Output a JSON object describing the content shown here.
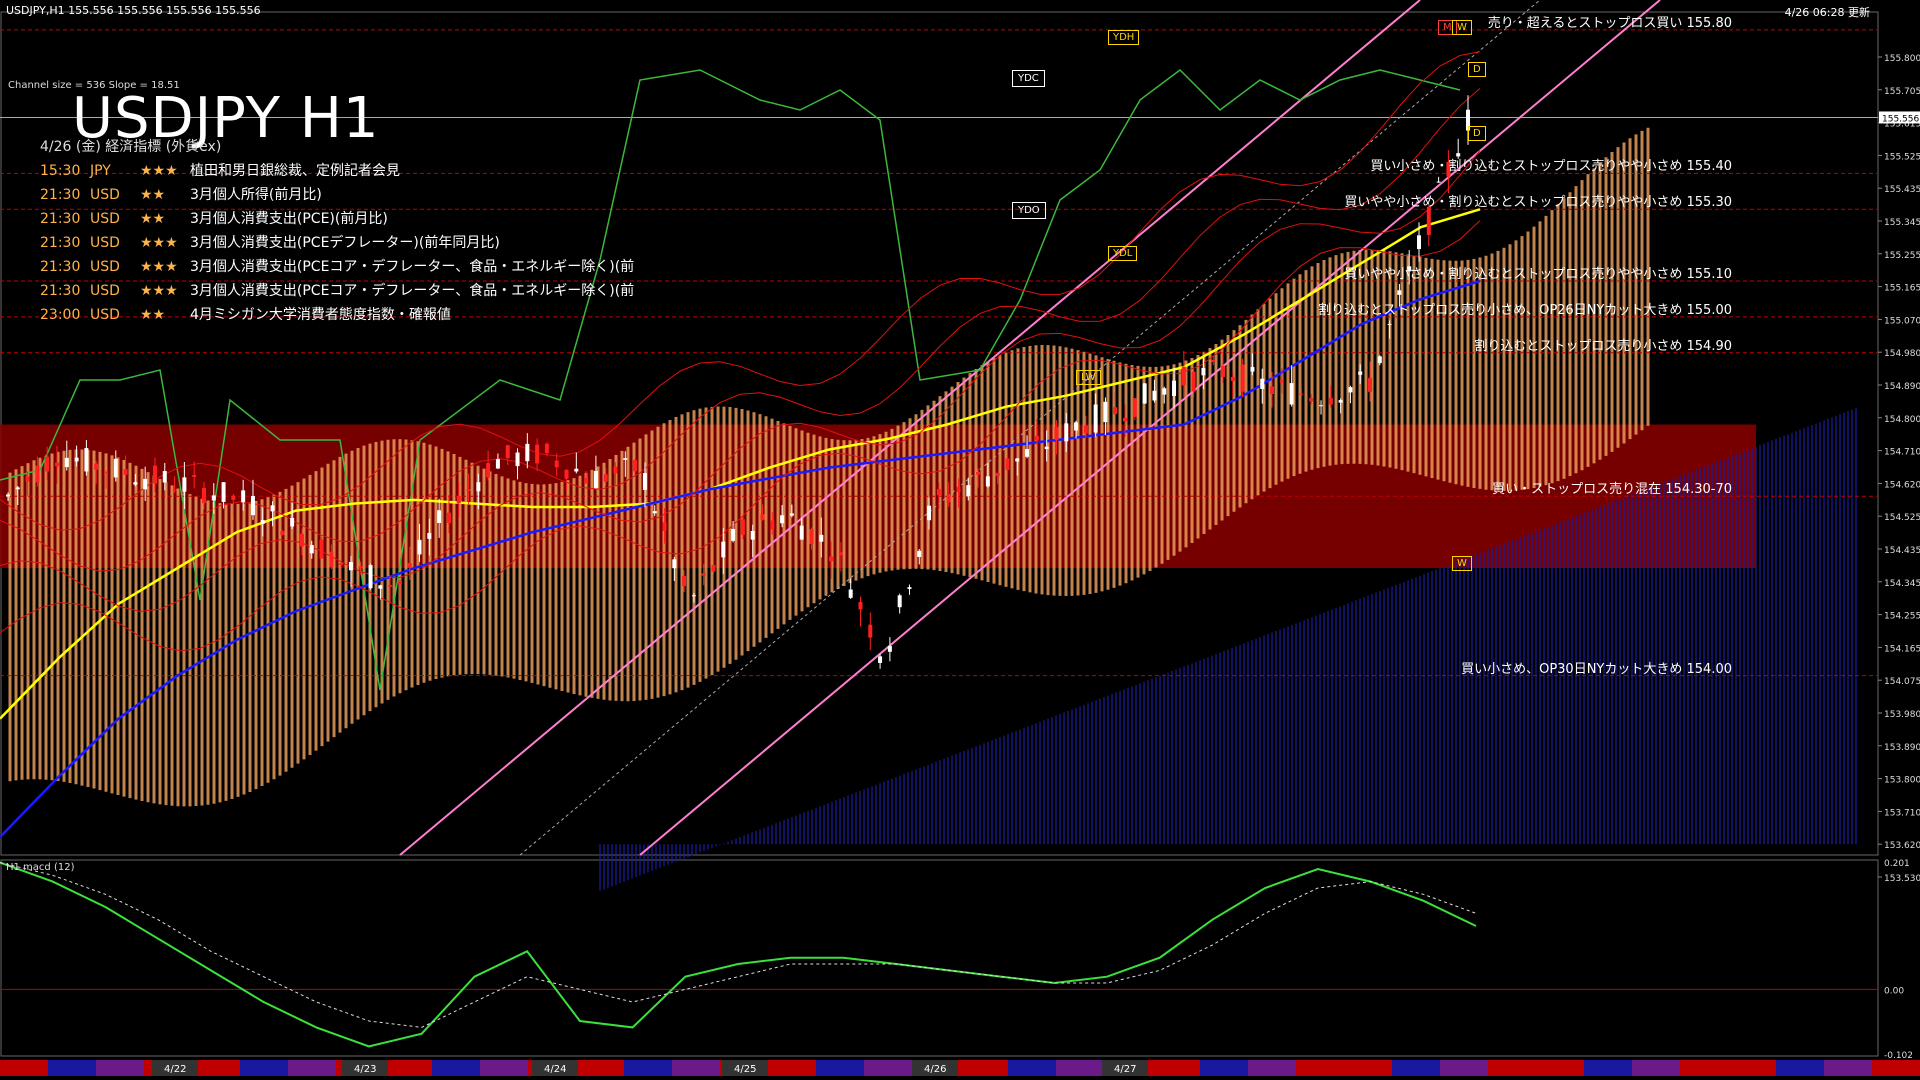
{
  "header": {
    "symbol_line": "USDJPY,H1  155.556 155.556 155.556 155.556",
    "channel_info": "Channel size = 536 Slope = 18.51",
    "title": "USDJPY H1",
    "timestamp": "4/26 06:28 更新"
  },
  "events": {
    "date_header": "4/26 (金) 経済指標 (外貨ex)",
    "items": [
      {
        "time": "15:30",
        "ccy": "JPY",
        "stars": "★★★",
        "name": "植田和男日銀総裁、定例記者会見"
      },
      {
        "time": "21:30",
        "ccy": "USD",
        "stars": "★★",
        "name": "3月個人所得(前月比)"
      },
      {
        "time": "21:30",
        "ccy": "USD",
        "stars": "★★",
        "name": "3月個人消費支出(PCE)(前月比)"
      },
      {
        "time": "21:30",
        "ccy": "USD",
        "stars": "★★★",
        "name": "3月個人消費支出(PCEデフレーター)(前年同月比)"
      },
      {
        "time": "21:30",
        "ccy": "USD",
        "stars": "★★★",
        "name": "3月個人消費支出(PCEコア・デフレーター、食品・エネルギー除く)(前"
      },
      {
        "time": "21:30",
        "ccy": "USD",
        "stars": "★★★",
        "name": "3月個人消費支出(PCEコア・デフレーター、食品・エネルギー除く)(前"
      },
      {
        "time": "23:00",
        "ccy": "USD",
        "stars": "★★",
        "name": "4月ミシガン大学消費者態度指数・確報値"
      }
    ]
  },
  "signals": [
    {
      "text": "売り・超えるとストップロス買い 155.80",
      "price": 155.8
    },
    {
      "text": "買い小さめ・割り込むとストップロス売りやや小さめ 155.40",
      "price": 155.4
    },
    {
      "text": "買いやや小さめ・割り込むとストップロス売りやや小さめ 155.30",
      "price": 155.3
    },
    {
      "text": "買いやや小さめ・割り込むとストップロス売りやや小さめ 155.10",
      "price": 155.1
    },
    {
      "text": "割り込むとストップロス売り小さめ、OP26日NYカット大きめ 155.00",
      "price": 155.0
    },
    {
      "text": "割り込むとストップロス売り小さめ 154.90",
      "price": 154.9
    },
    {
      "text": "買い・ストップロス売り混在 154.30-70",
      "price": 154.5
    },
    {
      "text": "買い小さめ、OP30日NYカット大きめ 154.00",
      "price": 154.0
    }
  ],
  "tags": {
    "ydh": "YDH",
    "ydc": "YDC",
    "ydo": "YDO",
    "ydl": "YDL",
    "lw": "LW",
    "m": "M",
    "w": "W",
    "d1": "D",
    "d2": "D",
    "w2": "W"
  },
  "macd_label": "H1  macd (12)",
  "chart_data": [
    {
      "type": "line",
      "title": "USDJPY H1",
      "current_price": 155.556,
      "price_axis": {
        "ylim": [
          153.5,
          155.85
        ],
        "ticks": [
          "155.800",
          "155.705",
          "155.615",
          "155.525",
          "155.435",
          "155.345",
          "155.255",
          "155.165",
          "155.070",
          "154.980",
          "154.890",
          "154.800",
          "154.710",
          "154.620",
          "154.525",
          "154.435",
          "154.345",
          "154.255",
          "154.165",
          "154.075",
          "153.980",
          "153.890",
          "153.800",
          "153.710",
          "153.620",
          "153.530"
        ],
        "current_label": "155.556"
      },
      "x_axis": {
        "labels": [
          "4/22",
          "4/23",
          "4/24",
          "4/25",
          "4/26",
          "4/27"
        ]
      },
      "zone": {
        "name": "154.30-70",
        "low": 154.3,
        "high": 154.7,
        "color": "#8b0000"
      },
      "price_path": {
        "x": [
          0,
          10,
          20,
          30,
          40,
          50,
          60,
          70,
          80,
          90,
          100,
          110,
          120,
          130,
          140,
          150,
          160,
          170,
          180,
          190,
          200,
          210,
          220,
          230,
          240,
          250,
          260,
          270,
          280,
          290,
          300
        ],
        "y": [
          154.5,
          154.62,
          154.58,
          154.55,
          154.52,
          154.48,
          154.4,
          154.3,
          154.25,
          154.45,
          154.6,
          154.62,
          154.55,
          154.58,
          154.2,
          154.4,
          154.45,
          154.35,
          154.05,
          154.48,
          154.55,
          154.62,
          154.7,
          154.75,
          154.82,
          154.85,
          154.8,
          154.78,
          154.82,
          155.2,
          155.55
        ]
      },
      "series": [
        {
          "name": "",
          "color": "#ffff00",
          "values": [
            153.88,
            154.05,
            154.2,
            154.3,
            154.4,
            154.46,
            154.48,
            154.49,
            154.48,
            154.47,
            154.47,
            154.48,
            154.52,
            154.58,
            154.63,
            154.66,
            154.7,
            154.75,
            154.78,
            154.82,
            154.86,
            154.95,
            155.05,
            155.15,
            155.25,
            155.3
          ]
        },
        {
          "name": "",
          "color": "#1a1aff",
          "values": [
            153.55,
            153.72,
            153.88,
            154.0,
            154.1,
            154.18,
            154.24,
            154.3,
            154.35,
            154.4,
            154.44,
            154.48,
            154.52,
            154.55,
            154.58,
            154.6,
            154.62,
            154.64,
            154.66,
            154.68,
            154.7,
            154.78,
            154.88,
            154.98,
            155.05,
            155.1
          ]
        }
      ],
      "macd": {
        "ylim": [
          -0.102,
          0.201
        ],
        "ticks": [
          "0.201",
          "0.00",
          "-0.102"
        ],
        "main": [
          0.2,
          0.17,
          0.13,
          0.08,
          0.03,
          -0.02,
          -0.06,
          -0.09,
          -0.07,
          0.02,
          0.06,
          -0.05,
          -0.06,
          0.02,
          0.04,
          0.05,
          0.05,
          0.04,
          0.03,
          0.02,
          0.01,
          0.02,
          0.05,
          0.11,
          0.16,
          0.19,
          0.17,
          0.14,
          0.1
        ],
        "signal": [
          0.2,
          0.18,
          0.15,
          0.11,
          0.06,
          0.02,
          -0.02,
          -0.05,
          -0.06,
          -0.02,
          0.02,
          0.0,
          -0.02,
          0.0,
          0.02,
          0.04,
          0.04,
          0.04,
          0.03,
          0.02,
          0.01,
          0.01,
          0.03,
          0.07,
          0.12,
          0.16,
          0.17,
          0.15,
          0.12
        ]
      }
    }
  ]
}
